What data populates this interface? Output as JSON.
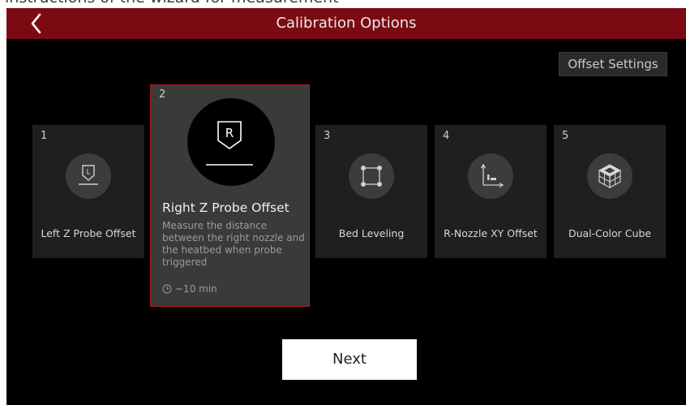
{
  "caption": "instructions of the wizard for measurement",
  "header": {
    "title": "Calibration Options"
  },
  "offset_button": "Offset Settings",
  "cards": [
    {
      "num": "1",
      "label": "Left Z Probe Offset",
      "icon": "left-z-probe-icon"
    },
    {
      "num": "2",
      "title": "Right Z Probe Offset",
      "description": "Measure the distance between the right nozzle and the heatbed when probe triggered",
      "time": "~10 min",
      "icon": "right-z-probe-icon",
      "selected": true
    },
    {
      "num": "3",
      "label": "Bed Leveling",
      "icon": "bed-leveling-icon"
    },
    {
      "num": "4",
      "label": "R-Nozzle XY Offset",
      "icon": "xy-offset-icon"
    },
    {
      "num": "5",
      "label": "Dual-Color Cube",
      "icon": "cube-icon"
    }
  ],
  "next_button": "Next",
  "colors": {
    "title_bar": "#7c0a12",
    "selected_border": "#b21a22",
    "background": "#000000"
  }
}
